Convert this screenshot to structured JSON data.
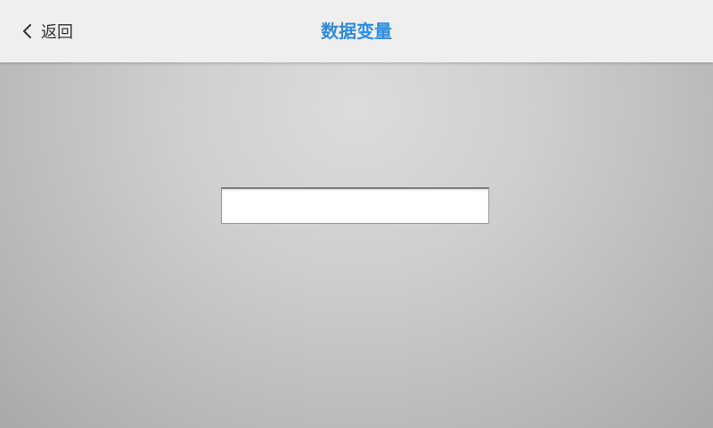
{
  "header": {
    "back_label": "返回",
    "title": "数据变量",
    "title_color": "#2d8de0"
  },
  "icons": {
    "back": "chevron-left-icon"
  },
  "main": {
    "input_value": "",
    "input_placeholder": ""
  }
}
